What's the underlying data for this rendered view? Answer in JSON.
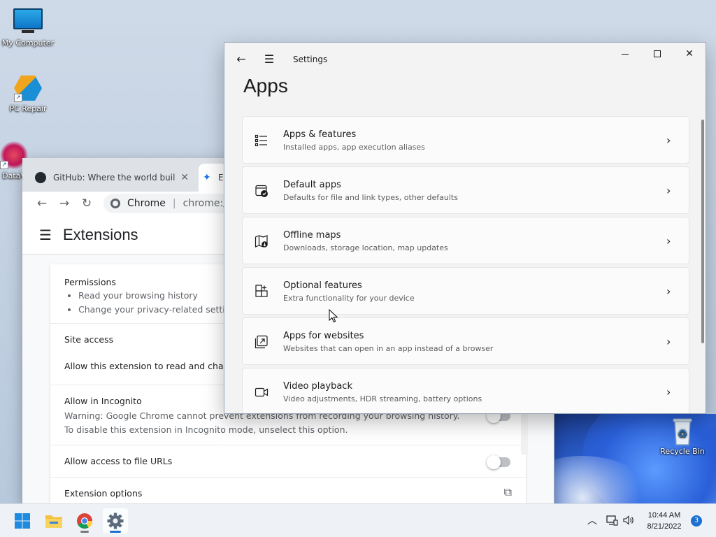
{
  "colors": {
    "accent": "#1a6fd1",
    "settings_bg": "#f3f3f3",
    "card_bg": "#fbfbfb",
    "chrome_tabstrip": "#dee1e6"
  },
  "desktop": {
    "icons": [
      {
        "label": "My Computer",
        "icon": "monitor-icon"
      },
      {
        "label": "PC Repair",
        "icon": "pc-repair-icon"
      },
      {
        "label": "DataV",
        "icon": "data-viewer-icon"
      },
      {
        "label": "Recycle Bin",
        "icon": "recycle-bin-icon"
      }
    ]
  },
  "chrome": {
    "tab1_title": "GitHub: Where the world builds s",
    "tab1_close": "✕",
    "tab2_title": "E",
    "omnibox_site": "Chrome",
    "omnibox_url": "chrome://ext",
    "page_title": "Extensions",
    "permissions_label": "Permissions",
    "permissions": [
      "Read your browsing history",
      "Change your privacy-related settings"
    ],
    "site_access_label": "Site access",
    "site_access_text": "Allow this extension to read and change",
    "incognito_label": "Allow in Incognito",
    "incognito_warning": "Warning: Google Chrome cannot prevent extensions from recording your browsing history. To disable this extension in Incognito mode, unselect this option.",
    "file_urls_label": "Allow access to file URLs",
    "ext_options_label": "Extension options"
  },
  "settings": {
    "app_title": "Settings",
    "page_title": "Apps",
    "items": [
      {
        "label": "Apps & features",
        "desc": "Installed apps, app execution aliases",
        "icon": "list-icon"
      },
      {
        "label": "Default apps",
        "desc": "Defaults for file and link types, other defaults",
        "icon": "default-apps-icon"
      },
      {
        "label": "Offline maps",
        "desc": "Downloads, storage location, map updates",
        "icon": "map-icon"
      },
      {
        "label": "Optional features",
        "desc": "Extra functionality for your device",
        "icon": "add-grid-icon"
      },
      {
        "label": "Apps for websites",
        "desc": "Websites that can open in an app instead of a browser",
        "icon": "open-in-app-icon"
      },
      {
        "label": "Video playback",
        "desc": "Video adjustments, HDR streaming, battery options",
        "icon": "video-icon"
      }
    ]
  },
  "taskbar": {
    "time": "10:44 AM",
    "date": "8/21/2022",
    "notifications": "3"
  }
}
